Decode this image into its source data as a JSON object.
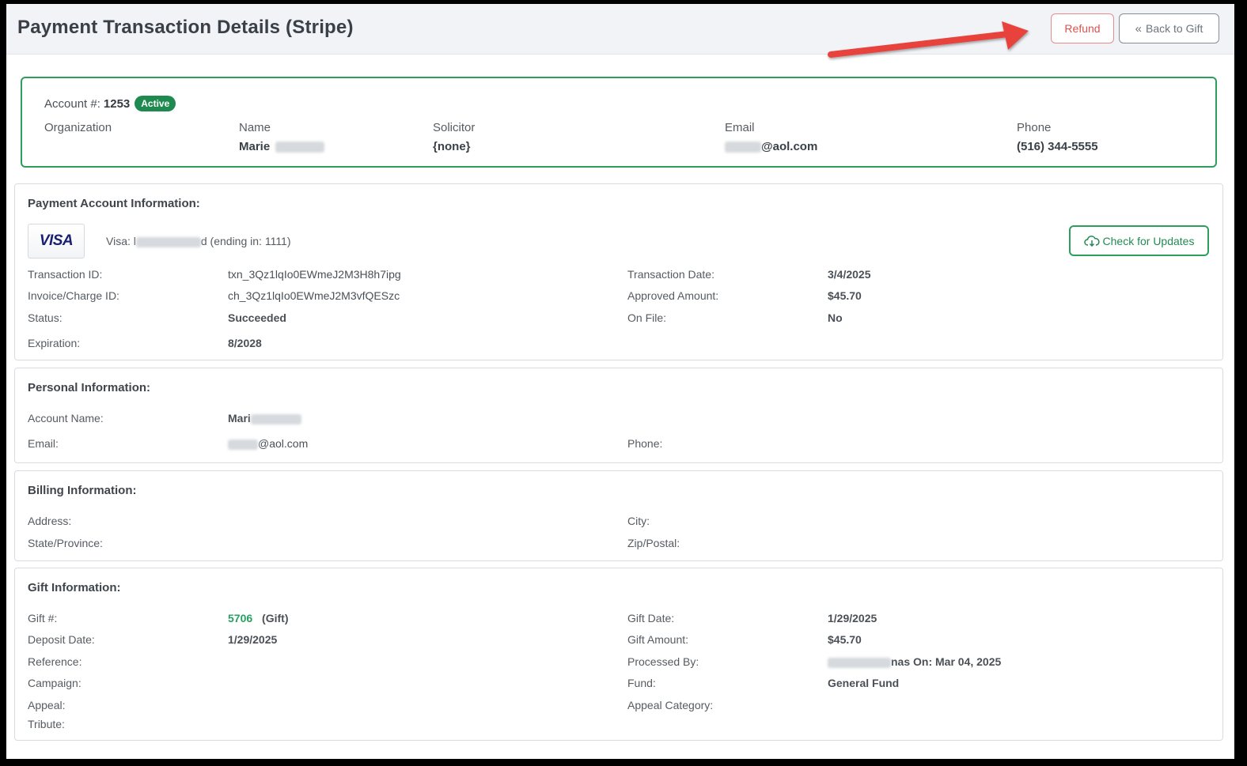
{
  "header": {
    "title": "Payment Transaction Details (Stripe)",
    "refund_label": "Refund",
    "back_label": "Back to Gift"
  },
  "account": {
    "account_label": "Account #:",
    "account_number": "1253",
    "status_badge": "Active",
    "organization_label": "Organization",
    "name_label": "Name",
    "name_value": "Marie",
    "solicitor_label": "Solicitor",
    "solicitor_value": "{none}",
    "email_label": "Email",
    "email_value": "@aol.com",
    "phone_label": "Phone",
    "phone_value": "(516) 344-5555"
  },
  "payment": {
    "title": "Payment Account Information:",
    "card_brand": "VISA",
    "card_prefix": "Visa: l",
    "card_suffix": "d (ending in: 1111)",
    "check_updates_label": "Check for Updates",
    "transaction_id_label": "Transaction ID:",
    "transaction_id": "txn_3Qz1lqIo0EWmeJ2M3H8h7ipg",
    "invoice_label": "Invoice/Charge ID:",
    "invoice_id": "ch_3Qz1lqIo0EWmeJ2M3vfQESzc",
    "status_label": "Status:",
    "status": "Succeeded",
    "expiration_label": "Expiration:",
    "expiration": "8/2028",
    "transaction_date_label": "Transaction Date:",
    "transaction_date": "3/4/2025",
    "approved_amount_label": "Approved Amount:",
    "approved_amount": "$45.70",
    "on_file_label": "On File:",
    "on_file": "No"
  },
  "personal": {
    "title": "Personal Information:",
    "account_name_label": "Account Name:",
    "account_name": "Mari",
    "email_label": "Email:",
    "email": "@aol.com",
    "phone_label": "Phone:"
  },
  "billing": {
    "title": "Billing Information:",
    "address_label": "Address:",
    "state_label": "State/Province:",
    "city_label": "City:",
    "zip_label": "Zip/Postal:"
  },
  "gift": {
    "title": "Gift Information:",
    "gift_number_label": "Gift #:",
    "gift_number": "5706",
    "gift_type": "(Gift)",
    "deposit_date_label": "Deposit Date:",
    "deposit_date": "1/29/2025",
    "reference_label": "Reference:",
    "campaign_label": "Campaign:",
    "appeal_label": "Appeal:",
    "tribute_label": "Tribute:",
    "gift_date_label": "Gift Date:",
    "gift_date": "1/29/2025",
    "gift_amount_label": "Gift Amount:",
    "gift_amount": "$45.70",
    "processed_by_label": "Processed By:",
    "processed_by_suffix": "nas On: Mar 04, 2025",
    "fund_label": "Fund:",
    "fund": "General Fund",
    "appeal_category_label": "Appeal Category:"
  },
  "colors": {
    "accent_green": "#2e9e5e",
    "refund_red": "#d9534f",
    "annotation_arrow": "#e8423c"
  }
}
